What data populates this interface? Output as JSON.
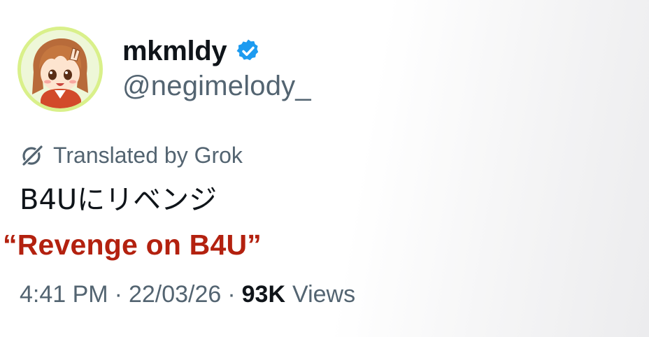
{
  "author": {
    "display_name": "mkmldy",
    "handle": "@negimelody_",
    "verified": true,
    "avatar_icon": "anime-character-avatar",
    "verified_icon": "verified-badge-icon",
    "verified_color": "#1d9bf0"
  },
  "translation_notice": {
    "icon": "grok-icon",
    "label": "Translated by Grok"
  },
  "post": {
    "original_text": "B4Uにリベンジ",
    "translation_overlay": "“Revenge on B4U”",
    "translation_color": "#b3210f"
  },
  "meta": {
    "time": "4:41 PM",
    "separator": "·",
    "date": "22/03/26",
    "views_count": "93K",
    "views_label": "Views"
  }
}
